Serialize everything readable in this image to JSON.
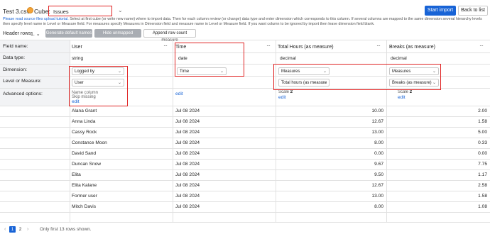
{
  "header": {
    "file_title": "Test 3.csv",
    "cube_label": "Cube:",
    "cube_value": "Issues",
    "chevron": "⌄",
    "start_import": "Start import",
    "back_to_list": "Back to list"
  },
  "instructions": {
    "link": "Please read source files upload tutorial.",
    "text": "Select at first cube (or write new name) where to import data. Then for each column review (or change) data type and enter dimension which corresponds to this column. If several columns are mapped to the same dimension several hierarchy levels then specify level name in Level or Measure field. For measures specify Measures in Dimension field and measure name in Level or Measure field. If you want column to be ignored by import then leave dimension field blank."
  },
  "toolbar": {
    "header_rows_label": "Header rows",
    "header_rows_value": "1.",
    "chevron": "⌄",
    "generate_default_names": "Generate default names",
    "hide_unmapped_columns": "Hide unmapped columns",
    "append_row_count_measure": "Append row count measure"
  },
  "labels": {
    "field_name": "Field name:",
    "data_type": "Data type:",
    "dimension": "Dimension:",
    "level_or_measure": "Level or Measure:",
    "advanced_options": "Advanced options:"
  },
  "columns": [
    {
      "field_name": "User",
      "data_type": "string",
      "dimension": "Logged by",
      "level": "User",
      "note1": "Name column",
      "note2": "Skip missing",
      "edit": "edit"
    },
    {
      "field_name": "Time",
      "data_type": "date",
      "dimension": "Time",
      "level": "",
      "edit": "edit"
    },
    {
      "field_name": "Total Hours (as measure)",
      "data_type": "decimal",
      "dimension": "Measures",
      "level": "Total hours (as measure",
      "scale_label": "Scale",
      "scale_value": "2",
      "edit": "edit"
    },
    {
      "field_name": "Breaks (as measure)",
      "data_type": "decimal",
      "dimension": "Measures",
      "level": "Breaks (as measure)",
      "scale_label": "Scale",
      "scale_value": "2",
      "edit": "edit"
    }
  ],
  "icons": {
    "menu": "···",
    "chevron": "⌄",
    "prev": "‹",
    "next": "›"
  },
  "rows": [
    {
      "user": "Alana Grant",
      "time": "Jul 08 2024",
      "total": "10.00",
      "breaks": "2.00"
    },
    {
      "user": "Anna Linda",
      "time": "Jul 08 2024",
      "total": "12.67",
      "breaks": "1.58"
    },
    {
      "user": "Cassy Rock",
      "time": "Jul 08 2024",
      "total": "13.00",
      "breaks": "5.00"
    },
    {
      "user": "Constance Moon",
      "time": "Jul 08 2024",
      "total": "8.00",
      "breaks": "0.33"
    },
    {
      "user": "David Sand",
      "time": "Jul 08 2024",
      "total": "0.00",
      "breaks": "0.00"
    },
    {
      "user": "Duncan Snow",
      "time": "Jul 08 2024",
      "total": "9.67",
      "breaks": "7.75"
    },
    {
      "user": "Elita",
      "time": "Jul 08 2024",
      "total": "9.50",
      "breaks": "1.17"
    },
    {
      "user": "Elita Kalane",
      "time": "Jul 08 2024",
      "total": "12.67",
      "breaks": "2.58"
    },
    {
      "user": "Former user",
      "time": "Jul 08 2024",
      "total": "13.00",
      "breaks": "1.58"
    },
    {
      "user": "Mitch Davis",
      "time": "Jul 08 2024",
      "total": "8.00",
      "breaks": "1.08"
    }
  ],
  "pager": {
    "page1": "1",
    "page2": "2",
    "note": "Only first 13 rows shown."
  },
  "colors": {
    "primary": "#1763d6",
    "highlight": "#e02424"
  }
}
